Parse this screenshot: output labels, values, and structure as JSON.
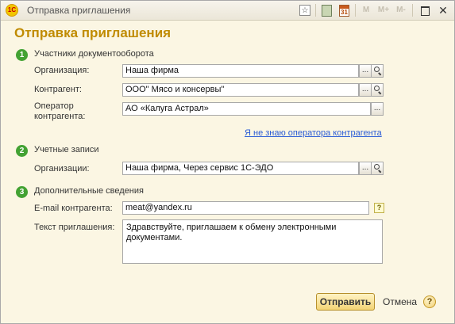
{
  "window": {
    "title": "Отправка приглашения",
    "app_icon_text": "1С"
  },
  "toolbar": {
    "calendar_icon_text": "31",
    "m_label": "M",
    "m_plus_label": "M+",
    "m_minus_label": "M-"
  },
  "page": {
    "title": "Отправка приглашения"
  },
  "sections": [
    {
      "number": "1",
      "title": "Участники документооборота"
    },
    {
      "number": "2",
      "title": "Учетные записи"
    },
    {
      "number": "3",
      "title": "Дополнительные сведения"
    }
  ],
  "participants": {
    "organization_label": "Организация:",
    "organization_value": "Наша фирма",
    "counterparty_label": "Контрагент:",
    "counterparty_value": "ООО\" Мясо и консервы\"",
    "operator_label_line1": "Оператор",
    "operator_label_line2": "контрагента:",
    "operator_value": "АО «Калуга Астрал»",
    "unknown_operator_link": "Я не знаю оператора контрагента"
  },
  "accounts": {
    "organizations_label": "Организации:",
    "organizations_value": "Наша фирма, Через сервис 1С-ЭДО"
  },
  "additional": {
    "email_label": "E-mail контрагента:",
    "email_value": "meat@yandex.ru",
    "email_help": "?",
    "invitation_label": "Текст приглашения:",
    "invitation_text": "Здравствуйте, приглашаем к обмену электронными документами."
  },
  "buttons": {
    "choose": "...",
    "send": "Отправить",
    "cancel": "Отмена",
    "help": "?"
  },
  "colors": {
    "accent_title": "#c08b00",
    "step_badge": "#43a233",
    "link": "#2b5cd6",
    "background": "#fbf6e3"
  }
}
